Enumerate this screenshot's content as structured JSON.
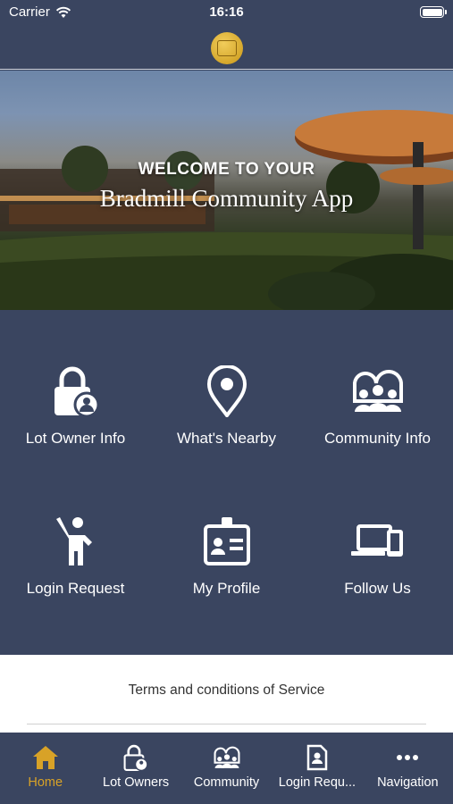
{
  "status_bar": {
    "carrier": "Carrier",
    "time": "16:16"
  },
  "hero": {
    "welcome": "WELCOME TO YOUR",
    "title": "Bradmill Community App"
  },
  "grid": {
    "items": [
      {
        "label": "Lot Owner Info",
        "icon": "lock-person-icon"
      },
      {
        "label": "What's Nearby",
        "icon": "location-pin-icon"
      },
      {
        "label": "Community Info",
        "icon": "community-icon"
      },
      {
        "label": "Login Request",
        "icon": "person-raise-hand-icon"
      },
      {
        "label": "My Profile",
        "icon": "id-badge-icon"
      },
      {
        "label": "Follow Us",
        "icon": "devices-icon"
      }
    ]
  },
  "terms": {
    "label": "Terms and conditions of Service"
  },
  "tabbar": {
    "active_color": "#d8a227",
    "tabs": [
      {
        "label": "Home",
        "icon": "home-icon"
      },
      {
        "label": "Lot Owners",
        "icon": "lock-person-icon"
      },
      {
        "label": "Community",
        "icon": "community-icon"
      },
      {
        "label": "Login Requ...",
        "icon": "document-person-icon"
      },
      {
        "label": "Navigation",
        "icon": "more-dots-icon"
      }
    ]
  },
  "colors": {
    "background": "#3a4560",
    "accent": "#d8a227"
  }
}
